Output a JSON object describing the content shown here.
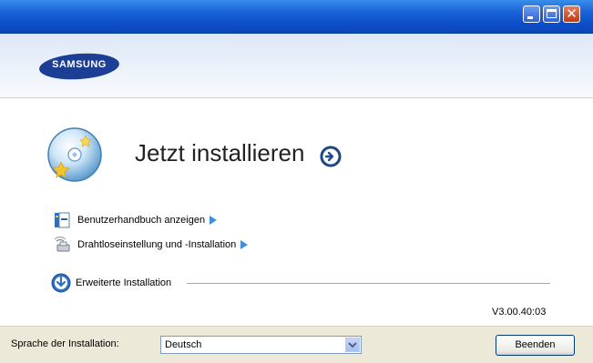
{
  "window": {
    "title": ""
  },
  "brand": {
    "logo_text": "SAMSUNG",
    "logo_color": "#1c3f95"
  },
  "main": {
    "install_title": "Jetzt installieren",
    "links": [
      {
        "label": "Benutzerhandbuch anzeigen",
        "icon": "manual-icon"
      },
      {
        "label": "Drahtloseinstellung und -Installation",
        "icon": "wireless-icon"
      }
    ],
    "advanced_label": "Erweiterte Installation",
    "version": "V3.00.40:03"
  },
  "footer": {
    "language_label": "Sprache der Installation:",
    "language_value": "Deutsch",
    "finish_label": "Beenden"
  },
  "colors": {
    "titlebar": "#0d4fc9",
    "accent_arrow": "#3d8fe0",
    "footer_bg": "#ece9d8"
  }
}
